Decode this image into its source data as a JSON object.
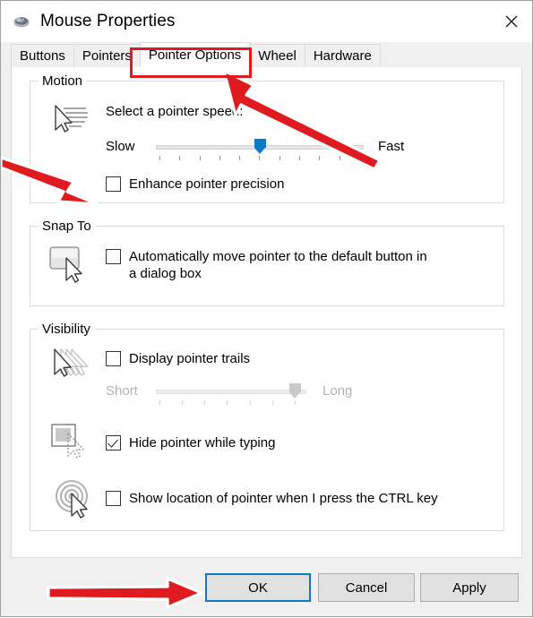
{
  "window": {
    "title": "Mouse Properties",
    "icon": "mouse-icon",
    "close_icon": "close-icon"
  },
  "tabs": [
    {
      "label": "Buttons",
      "active": false
    },
    {
      "label": "Pointers",
      "active": false
    },
    {
      "label": "Pointer Options",
      "active": true
    },
    {
      "label": "Wheel",
      "active": false
    },
    {
      "label": "Hardware",
      "active": false
    }
  ],
  "groups": {
    "motion": {
      "title": "Motion",
      "icon": "pointer-speed-icon",
      "speed_label": "Select a pointer speed:",
      "slider": {
        "name": "pointer-speed-slider",
        "min_label": "Slow",
        "max_label": "Fast",
        "value": 5,
        "min": 0,
        "max": 10,
        "ticks": 11,
        "enabled": true,
        "accent": "#0d7ac4"
      },
      "enhance_precision": {
        "label": "Enhance pointer precision",
        "checked": false
      }
    },
    "snap_to": {
      "title": "Snap To",
      "icon": "snap-to-button-icon",
      "auto_move": {
        "label": "Automatically move pointer to the default button in a dialog box",
        "checked": false
      }
    },
    "visibility": {
      "title": "Visibility",
      "trails_icon": "pointer-trails-icon",
      "hide_icon": "hide-pointer-typing-icon",
      "locate_icon": "locate-pointer-icon",
      "display_trails": {
        "label": "Display pointer trails",
        "checked": false
      },
      "trails_slider": {
        "name": "pointer-trails-slider",
        "min_label": "Short",
        "max_label": "Long",
        "value": 7,
        "min": 0,
        "max": 8,
        "ticks": 7,
        "enabled": false
      },
      "hide_while_typing": {
        "label": "Hide pointer while typing",
        "checked": true
      },
      "show_location": {
        "label": "Show location of pointer when I press the CTRL key",
        "checked": false
      }
    }
  },
  "footer": {
    "ok": "OK",
    "cancel": "Cancel",
    "apply": "Apply",
    "default_button": "OK"
  },
  "annotations": {
    "highlight_color": "#e01b20",
    "tab_highlight_target": "Pointer Options",
    "arrows": [
      {
        "name": "arrow-to-pointer-options-tab",
        "direction": "up-left"
      },
      {
        "name": "arrow-to-enhance-precision-checkbox",
        "direction": "down-right"
      },
      {
        "name": "arrow-to-ok-button",
        "direction": "right"
      }
    ]
  }
}
